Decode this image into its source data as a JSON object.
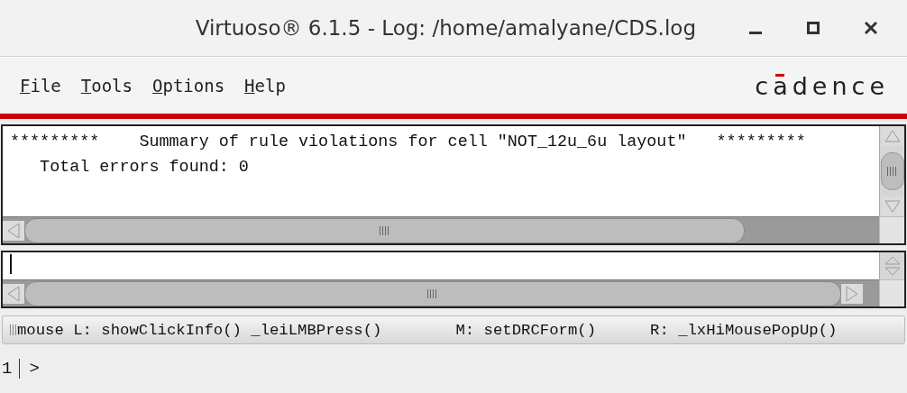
{
  "window": {
    "title": "Virtuoso® 6.1.5 - Log: /home/amalyane/CDS.log"
  },
  "menu": [
    {
      "label": "File"
    },
    {
      "label": "Tools"
    },
    {
      "label": "Options"
    },
    {
      "label": "Help"
    }
  ],
  "logo": {
    "text": "cadence"
  },
  "log_lines": [
    "*********    Summary of rule violations for cell \"NOT_12u_6u layout\"   *********",
    "   Total errors found: 0"
  ],
  "status_bar": [
    "mouse L: showClickInfo() _leiLMBPress()",
    "M: setDRCForm()",
    "R: _lxHiMousePopUp()"
  ],
  "prompt": {
    "line_number": "1",
    "symbol": ">"
  }
}
